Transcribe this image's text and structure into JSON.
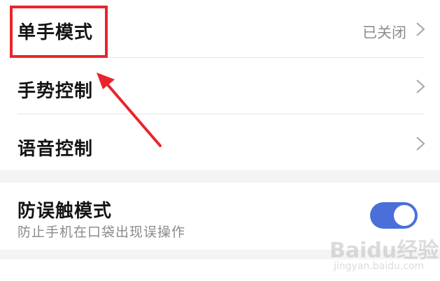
{
  "settings": {
    "one_hand_mode": {
      "label": "单手模式",
      "value": "已关闭"
    },
    "gesture_control": {
      "label": "手势控制"
    },
    "voice_control": {
      "label": "语音控制"
    },
    "accidental_touch": {
      "label": "防误触模式",
      "description": "防止手机在口袋出现误操作",
      "enabled": true
    }
  },
  "watermark": {
    "brand": "Baidu经验",
    "url": "jingyan.baidu.com"
  },
  "colors": {
    "toggle_on": "#4b6fd9",
    "annotation": "#e8252d"
  }
}
